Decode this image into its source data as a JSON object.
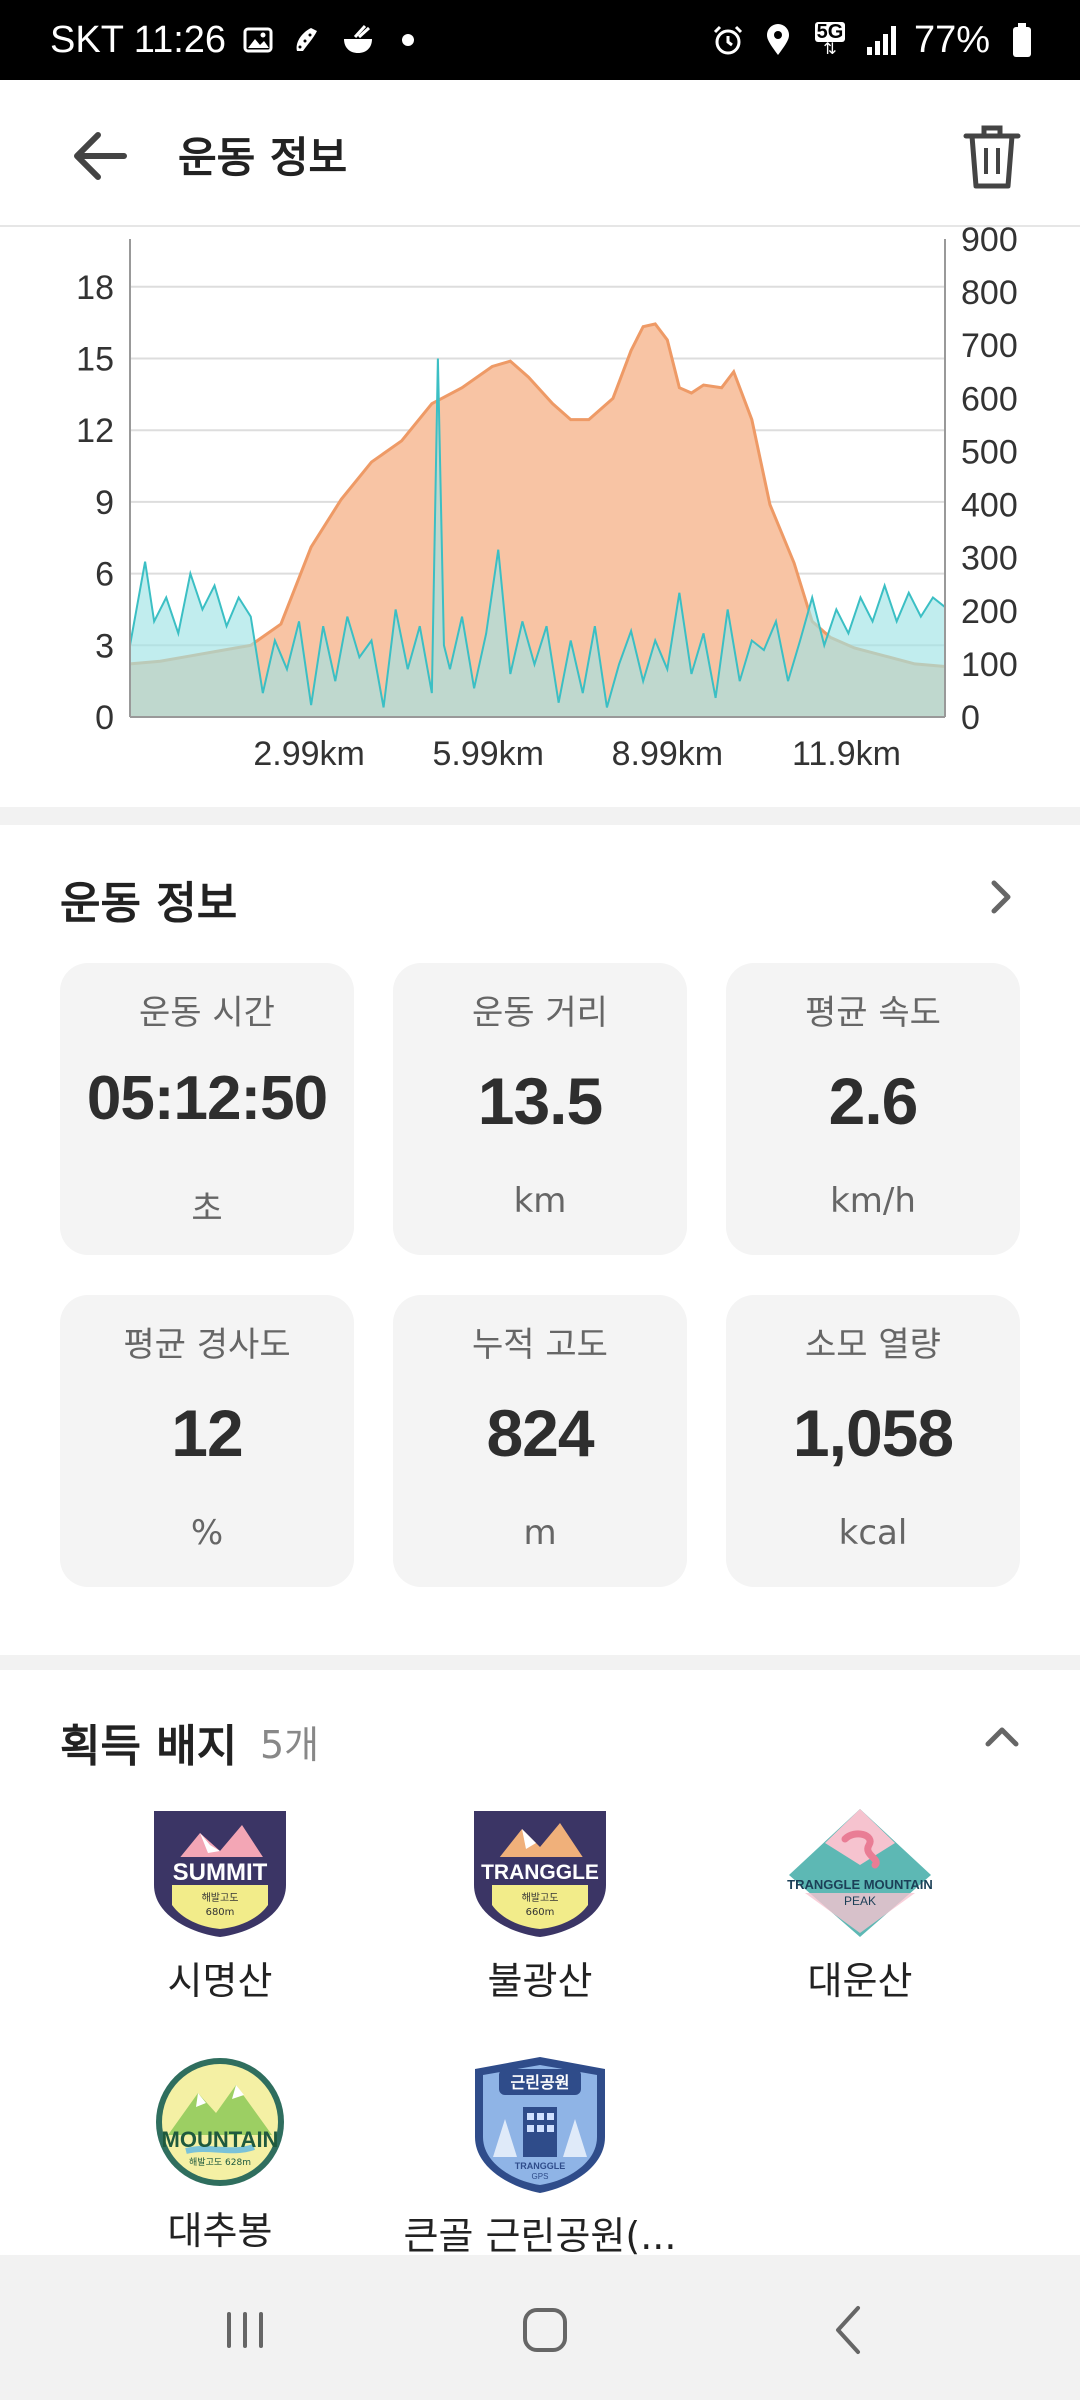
{
  "status_bar": {
    "carrier_time": "SKT 11:26",
    "battery": "77%",
    "network": "5G",
    "icons": [
      "gallery-icon",
      "shoe-icon",
      "bowl-icon",
      "dot-icon",
      "alarm-icon",
      "location-icon",
      "signal-icon",
      "battery-icon"
    ]
  },
  "header": {
    "title": "운동 정보",
    "back_icon": "arrow-left-icon",
    "delete_icon": "trash-icon"
  },
  "chart_data": {
    "type": "area",
    "x_tick_labels": [
      "2.99km",
      "5.99km",
      "8.99km",
      "11.9km"
    ],
    "y_left_ticks": [
      0,
      3,
      6,
      9,
      12,
      15,
      18
    ],
    "y_right_ticks": [
      0,
      100,
      200,
      300,
      400,
      500,
      600,
      700,
      800,
      900
    ],
    "ylim_left": [
      0,
      20
    ],
    "ylim_right": [
      0,
      900
    ],
    "xlim": [
      0,
      13.5
    ],
    "grid": true,
    "colors": {
      "elevation_fill": "#f8c4a4",
      "elevation_line": "#ee9a66",
      "speed_fill": "#9fe3e5",
      "speed_line": "#3bbfc4",
      "grid": "#dddddd"
    },
    "series": [
      {
        "axis": "right",
        "x": [
          0,
          0.5,
          1.0,
          1.5,
          2.0,
          2.5,
          3.0,
          3.5,
          4.0,
          4.5,
          5.0,
          5.5,
          6.0,
          6.3,
          6.6,
          7.0,
          7.3,
          7.6,
          8.0,
          8.3,
          8.5,
          8.7,
          8.9,
          9.1,
          9.3,
          9.5,
          9.8,
          10.0,
          10.3,
          10.6,
          11.0,
          11.3,
          11.6,
          12.0,
          12.5,
          13.0,
          13.5
        ],
        "y": [
          100,
          105,
          115,
          125,
          135,
          175,
          320,
          410,
          480,
          520,
          590,
          620,
          660,
          670,
          640,
          590,
          560,
          560,
          600,
          690,
          735,
          740,
          710,
          620,
          610,
          625,
          620,
          650,
          560,
          400,
          290,
          180,
          150,
          130,
          115,
          100,
          95
        ]
      },
      {
        "axis": "left",
        "x": [
          0,
          0.25,
          0.4,
          0.6,
          0.8,
          1.0,
          1.2,
          1.4,
          1.6,
          1.8,
          2.0,
          2.2,
          2.4,
          2.6,
          2.8,
          3.0,
          3.2,
          3.4,
          3.6,
          3.8,
          4.0,
          4.2,
          4.4,
          4.6,
          4.8,
          5.0,
          5.1,
          5.2,
          5.3,
          5.5,
          5.7,
          5.9,
          6.1,
          6.3,
          6.5,
          6.7,
          6.9,
          7.1,
          7.3,
          7.5,
          7.7,
          7.9,
          8.1,
          8.3,
          8.5,
          8.7,
          8.9,
          9.1,
          9.3,
          9.5,
          9.7,
          9.9,
          10.1,
          10.3,
          10.5,
          10.7,
          10.9,
          11.1,
          11.3,
          11.5,
          11.7,
          11.9,
          12.1,
          12.3,
          12.5,
          12.7,
          12.9,
          13.1,
          13.3,
          13.5
        ],
        "y": [
          3.0,
          6.5,
          4.0,
          5.0,
          3.5,
          6.0,
          4.5,
          5.5,
          3.8,
          5.0,
          4.2,
          1.0,
          3.2,
          2.0,
          4.0,
          0.5,
          3.8,
          1.5,
          4.2,
          2.5,
          3.2,
          0.4,
          4.5,
          2.0,
          3.8,
          1.0,
          15.0,
          3.0,
          2.0,
          4.2,
          1.2,
          3.5,
          7.0,
          1.8,
          4.0,
          2.2,
          3.8,
          0.6,
          3.2,
          1.0,
          3.8,
          0.4,
          2.2,
          3.6,
          1.5,
          3.2,
          2.0,
          5.2,
          1.8,
          3.5,
          0.8,
          4.5,
          1.5,
          3.2,
          2.8,
          4.0,
          1.5,
          3.2,
          5.0,
          3.0,
          4.5,
          3.5,
          5.0,
          4.0,
          5.5,
          4.0,
          5.2,
          4.2,
          5.0,
          4.6
        ]
      }
    ]
  },
  "info_section": {
    "title": "운동 정보",
    "chevron_icon": "chevron-right-icon",
    "tiles": [
      {
        "label": "운동 시간",
        "value": "05:12:50",
        "unit": "초"
      },
      {
        "label": "운동 거리",
        "value": "13.5",
        "unit": "km"
      },
      {
        "label": "평균 속도",
        "value": "2.6",
        "unit": "km/h"
      },
      {
        "label": "평균 경사도",
        "value": "12",
        "unit": "%"
      },
      {
        "label": "누적 고도",
        "value": "824",
        "unit": "m"
      },
      {
        "label": "소모 열량",
        "value": "1,058",
        "unit": "kcal"
      }
    ]
  },
  "badge_section": {
    "title": "획득 배지",
    "count": "5개",
    "collapse_icon": "chevron-up-icon",
    "badges": [
      {
        "name": "시명산",
        "badge_text": "SUMMIT",
        "sub_text": "해발고도",
        "alt_text": "680m"
      },
      {
        "name": "불광산",
        "badge_text": "TRANGGLE",
        "sub_text": "해발고도",
        "alt_text": "660m"
      },
      {
        "name": "대운산",
        "badge_text": "TRANGGLE MOUNTAIN",
        "sub_text": "PEAK"
      },
      {
        "name": "대추봉",
        "badge_text": "MOUNTAIN",
        "sub_text": "해발고도 628m"
      },
      {
        "name": "큰골 근린공원(...",
        "badge_text": "근린공원",
        "sub_text": "TRANGGLE",
        "alt_text": "GPS"
      }
    ]
  },
  "nav_bar": {
    "icons": [
      "recent-apps-icon",
      "home-icon",
      "back-icon"
    ]
  }
}
